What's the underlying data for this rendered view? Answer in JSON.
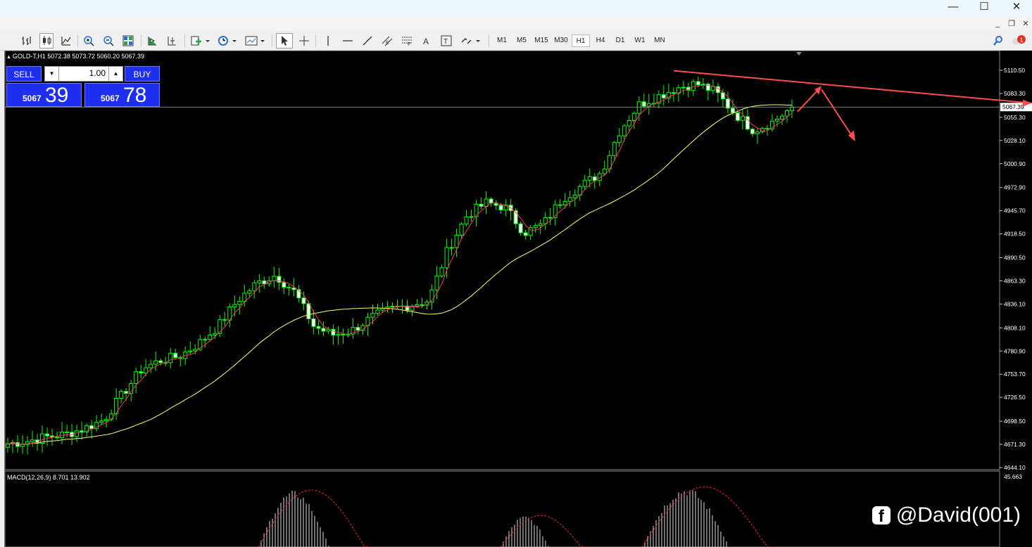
{
  "window": {
    "minimize_glyph": "—",
    "maximize_glyph": "☐",
    "close_glyph": "✕"
  },
  "mdi": {
    "minimize_glyph": "_",
    "restore_glyph": "❐",
    "close_glyph": "✕"
  },
  "toolbar": {
    "timeframes": [
      "M1",
      "M5",
      "M15",
      "M30",
      "H1",
      "H4",
      "D1",
      "W1",
      "MN"
    ],
    "active_timeframe": "H1",
    "notification_count": "1"
  },
  "chart": {
    "header": "GOLD-T,H1  5072.38 5073.72 5060.20 5067.39",
    "sell_label": "SELL",
    "buy_label": "BUY",
    "lot_value": "1.00",
    "sell_price_small": "5067",
    "sell_price_big": "39",
    "buy_price_small": "5067",
    "buy_price_big": "78",
    "current_price_label": "5067.39",
    "price_ticks": [
      "5110.50",
      "5083.30",
      "5055.30",
      "5028.10",
      "5000.90",
      "4972.90",
      "4945.70",
      "4918.50",
      "4890.50",
      "4863.30",
      "4836.10",
      "4808.10",
      "4780.90",
      "4753.70",
      "4726.50",
      "4698.50",
      "4671.30",
      "4644.10"
    ],
    "macd_label": "MACD(12,26,9) 8.701 13.902",
    "macd_top_tick": "45.663",
    "colors": {
      "bull": "#00ff00",
      "fast_ma": "#ff3366",
      "slow_ma": "#ffff66",
      "annotation": "#ff4d4d",
      "background": "#000000"
    }
  },
  "chart_data": {
    "type": "candlestick",
    "symbol": "GOLD-T",
    "timeframe": "H1",
    "ylim": [
      4644.1,
      5110.5
    ],
    "approx_close_path": [
      4672,
      4675,
      4680,
      4683,
      4690,
      4700,
      4730,
      4760,
      4770,
      4775,
      4790,
      4810,
      4840,
      4860,
      4870,
      4850,
      4810,
      4800,
      4805,
      4820,
      4830,
      4835,
      4840,
      4900,
      4940,
      4955,
      4950,
      4920,
      4930,
      4960,
      4975,
      4990,
      5040,
      5070,
      5080,
      5090,
      5095,
      5085,
      5060,
      5040,
      5050,
      5067
    ]
  },
  "watermark": {
    "logo_glyph": "f",
    "handle": "@David(001)"
  }
}
